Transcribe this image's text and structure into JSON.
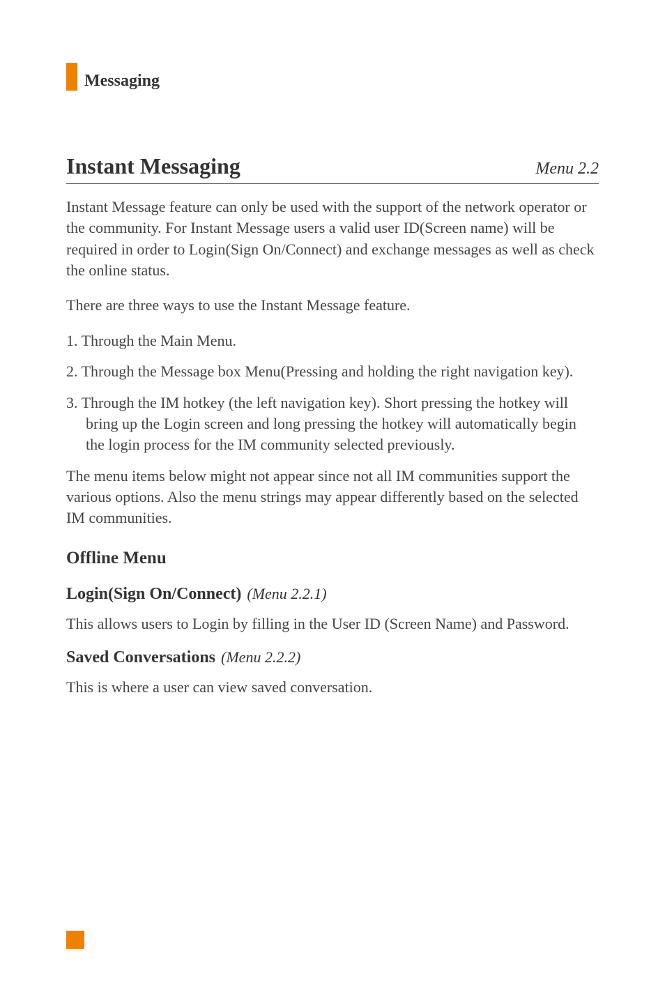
{
  "header": {
    "section": "Messaging"
  },
  "main": {
    "title": "Instant Messaging",
    "menuRef": "Menu 2.2",
    "intro": "Instant Message feature can only be used with the support of the network operator or the community. For Instant Message users a valid user ID(Screen name) will be required in order to Login(Sign On/Connect) and exchange messages as well as check the online status.",
    "waysIntro": "There are three ways to use the Instant Message feature.",
    "ways": [
      "1. Through the Main Menu.",
      "2. Through the Message box Menu(Pressing and holding the right navigation key).",
      "3. Through the IM hotkey (the left navigation key). Short pressing the hotkey will bring up the Login screen and long pressing the hotkey will automatically begin the login process for the IM community selected previously."
    ],
    "note": "The menu items below might not appear since not all IM communities support the various options. Also the menu strings may appear differently based on the selected IM communities."
  },
  "offline": {
    "heading": "Offline Menu",
    "login": {
      "title": "Login(Sign On/Connect)",
      "ref": "(Menu 2.2.1)",
      "body": "This allows users to Login by filling in the User ID (Screen Name) and Password."
    },
    "saved": {
      "title": "Saved Conversations",
      "ref": "(Menu 2.2.2)",
      "body": "This is where a user can view saved conversation."
    }
  }
}
